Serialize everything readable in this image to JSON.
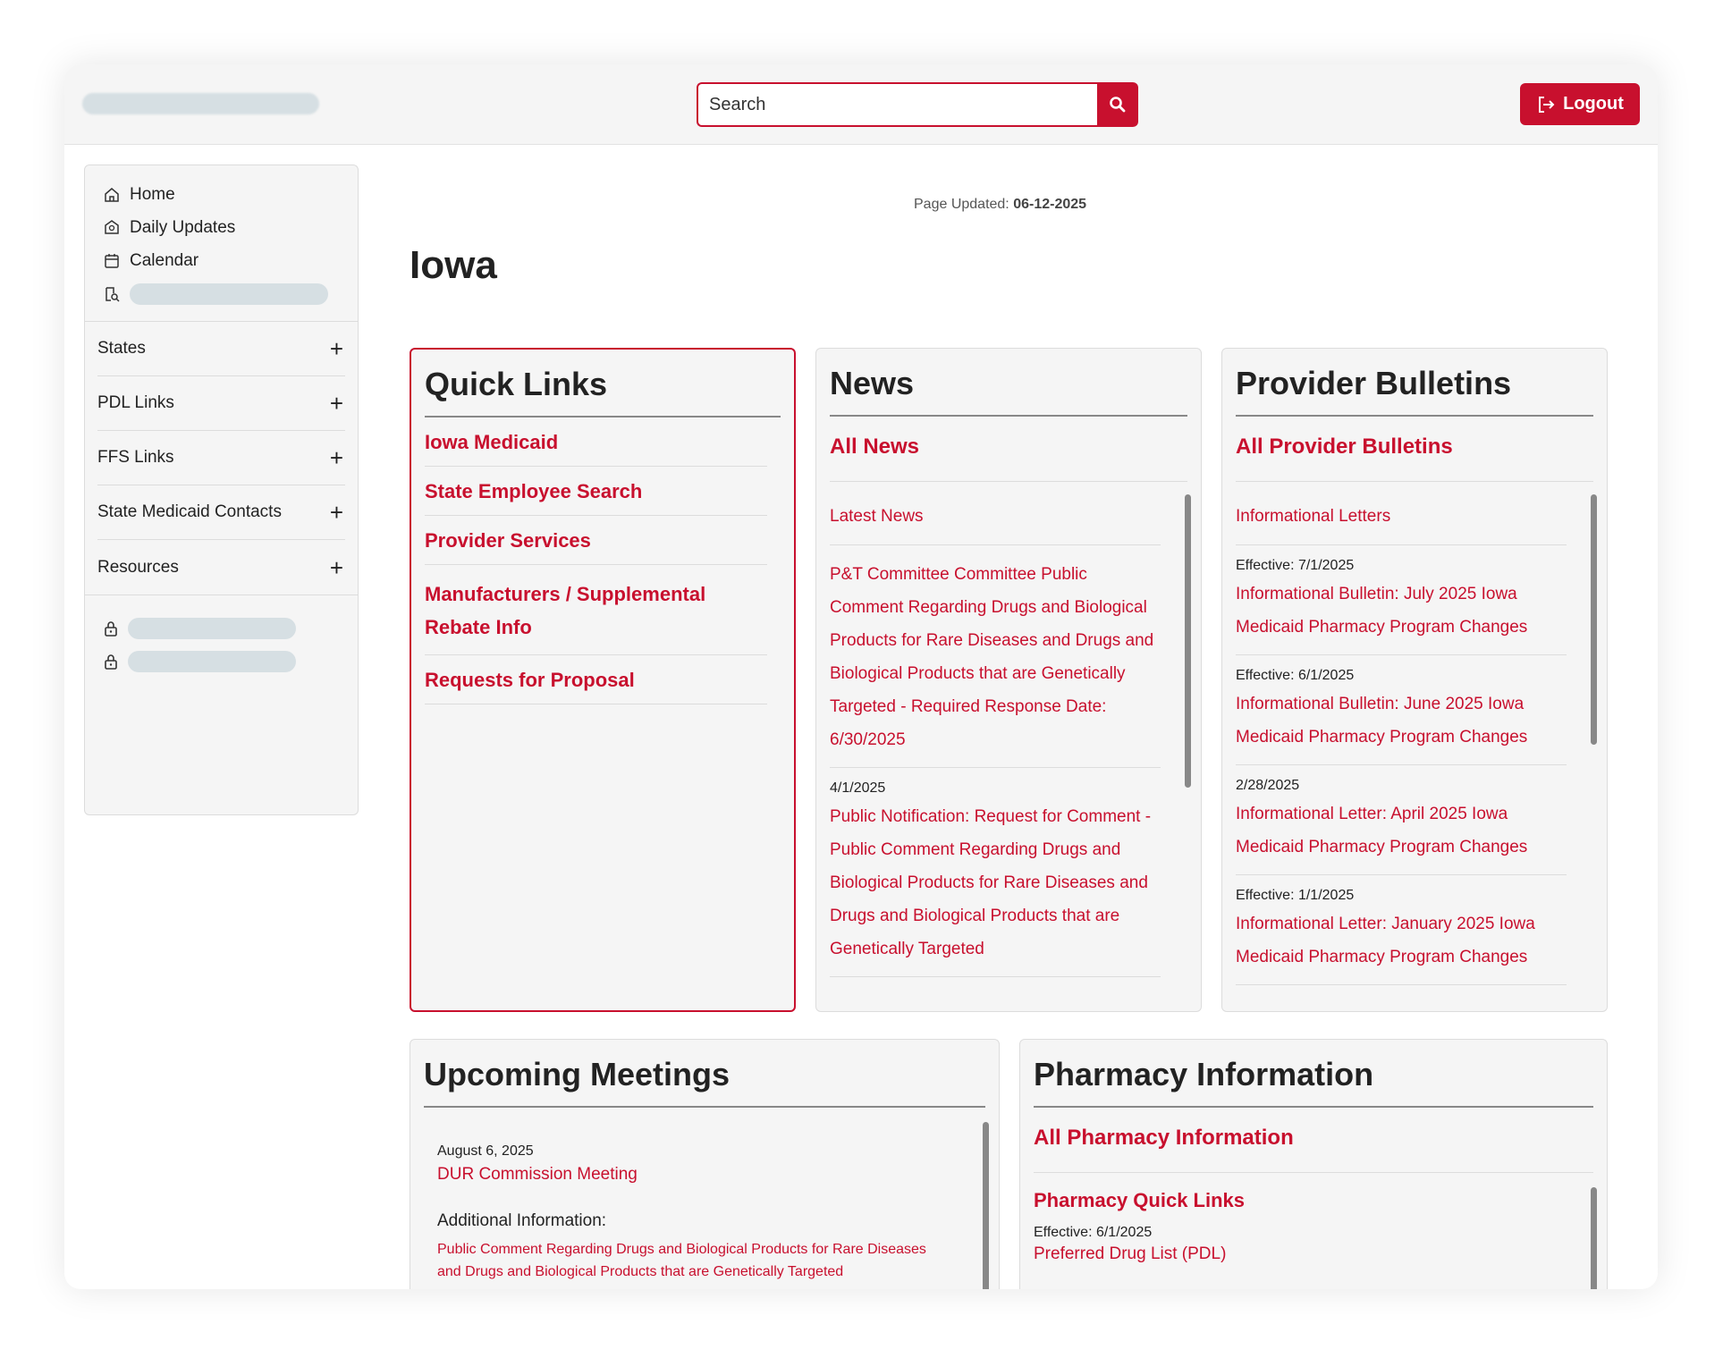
{
  "header": {
    "search_placeholder": "Search",
    "logout_label": "Logout"
  },
  "sidebar": {
    "top_items": [
      {
        "label": "Home",
        "icon": "home-icon"
      },
      {
        "label": "Daily Updates",
        "icon": "badge-icon"
      },
      {
        "label": "Calendar",
        "icon": "calendar-icon"
      }
    ],
    "accordion": [
      {
        "label": "States"
      },
      {
        "label": "PDL Links"
      },
      {
        "label": "FFS Links"
      },
      {
        "label": "State Medicaid Contacts"
      },
      {
        "label": "Resources"
      }
    ]
  },
  "page": {
    "updated_label": "Page Updated:",
    "updated_value": "06-12-2025",
    "title": "Iowa"
  },
  "quick_links": {
    "title": "Quick Links",
    "items": [
      "Iowa Medicaid",
      "State Employee Search",
      "Provider Services",
      "Manufacturers / Supplemental Rebate Info",
      "Requests for Proposal"
    ]
  },
  "news": {
    "title": "News",
    "all_link": "All News",
    "section_head": "Latest News",
    "items": [
      {
        "date": "",
        "text": "P&T Committee Committee Public Comment Regarding Drugs and Biological Products for Rare Diseases and Drugs and Biological Products that are Genetically Targeted - Required Response Date: 6/30/2025"
      },
      {
        "date": "4/1/2025",
        "text": "Public Notification: Request for Comment - Public Comment Regarding Drugs and Biological Products for Rare Diseases and Drugs and Biological Products that are Genetically Targeted"
      }
    ]
  },
  "bulletins": {
    "title": "Provider Bulletins",
    "all_link": "All Provider Bulletins",
    "section_head": "Informational Letters",
    "items": [
      {
        "date": "Effective: 7/1/2025",
        "text": "Informational Bulletin: July 2025 Iowa Medicaid Pharmacy Program Changes"
      },
      {
        "date": "Effective: 6/1/2025",
        "text": "Informational Bulletin: June 2025 Iowa Medicaid Pharmacy Program Changes"
      },
      {
        "date": "2/28/2025",
        "text": "Informational Letter: April 2025 Iowa Medicaid Pharmacy Program Changes"
      },
      {
        "date": "Effective: 1/1/2025",
        "text": "Informational Letter: January 2025 Iowa Medicaid Pharmacy Program Changes"
      }
    ]
  },
  "meetings": {
    "title": "Upcoming Meetings",
    "date": "August 6, 2025",
    "link": "DUR Commission Meeting",
    "additional_label": "Additional Information:",
    "additional_text": "Public Comment Regarding Drugs and Biological Products for Rare Diseases and Drugs and Biological Products that are Genetically Targeted"
  },
  "pharmacy": {
    "title": "Pharmacy Information",
    "all_link": "All Pharmacy Information",
    "quick_links_head": "Pharmacy Quick Links",
    "date": "Effective: 6/1/2025",
    "link": "Preferred Drug List (PDL)"
  },
  "colors": {
    "accent": "#c8102e",
    "panel_bg": "#f5f5f5"
  }
}
